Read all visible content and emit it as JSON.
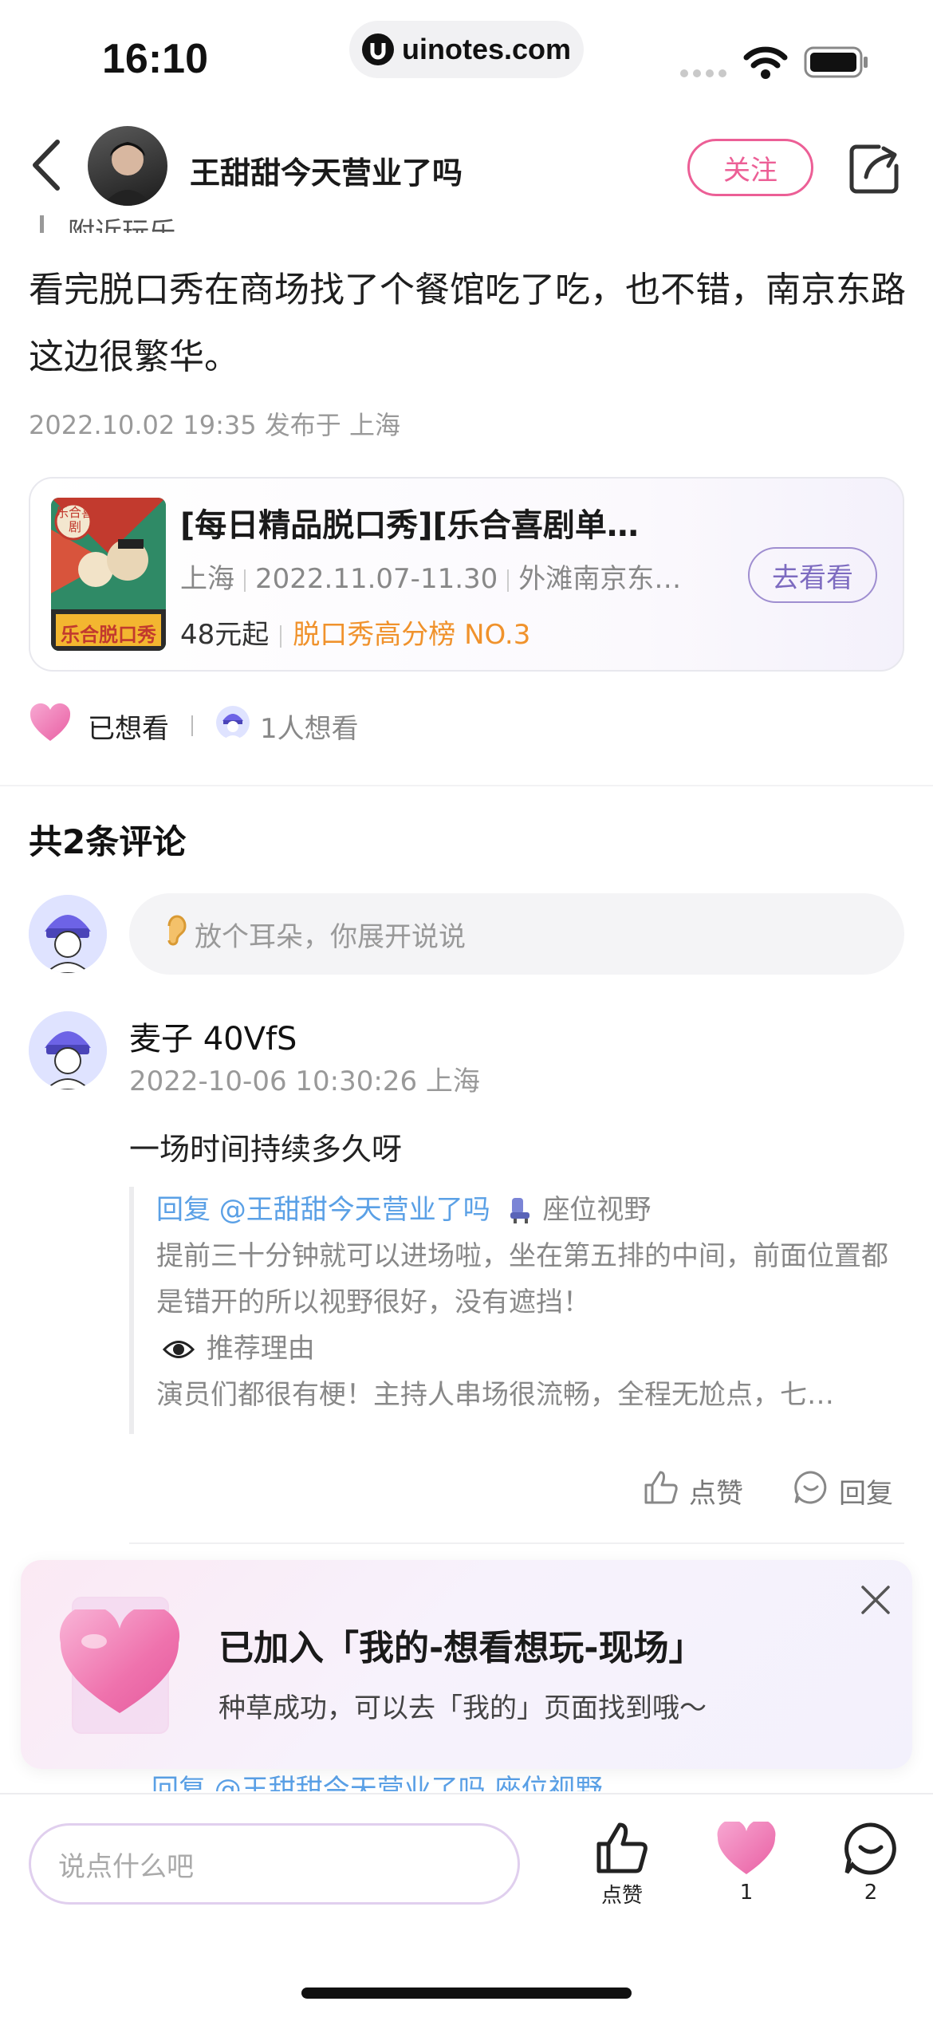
{
  "status_bar": {
    "time": "16:10",
    "url": "uinotes.com"
  },
  "header": {
    "author_name": "王甜甜今天营业了吗",
    "follow_label": "关注"
  },
  "post": {
    "cut_tag": "附近玩乐",
    "body": "看完脱口秀在商场找了个餐馆吃了吃，也不错，南京东路这边很繁华。",
    "meta": "2022.10.02 19:35 发布于 上海"
  },
  "show_card": {
    "title": "[每日精品脱口秀][乐合喜剧单…",
    "city": "上海",
    "dates": "2022.11.07-11.30",
    "venue": "外滩南京东…",
    "price": "48元起",
    "rank": "脱口秀高分榜 NO.3",
    "go_label": "去看看",
    "poster_text_top": "乐合喜剧",
    "poster_text_bottom": "乐合脱口秀"
  },
  "want_row": {
    "label": "已想看",
    "count": "1人想看"
  },
  "comments": {
    "title": "共2条评论",
    "input_placeholder": "放个耳朵，你展开说说",
    "items": [
      {
        "user": "麦子 40VfS",
        "meta": "2022-10-06 10:30:26 上海",
        "text": "一场时间持续多久呀",
        "reply_prefix": "回复 @王甜甜今天营业了吗",
        "reply_seat_label": "座位视野",
        "reply_body": "提前三十分钟就可以进场啦，坐在第五排的中间，前面位置都是错开的所以视野很好，没有遮挡！",
        "reason_label": "推荐理由",
        "reason_text": "演员们都很有梗！主持人串场很流畅，全程无尬点，七…",
        "like_label": "点赞",
        "reply_label": "回复"
      }
    ],
    "next_reply_peek": "回复 @王甜甜今天营业了吗  座位视野"
  },
  "toast": {
    "title": "已加入「我的-想看想玩-现场」",
    "subtitle": "种草成功，可以去「我的」页面找到哦～"
  },
  "bottom_bar": {
    "input_placeholder": "说点什么吧",
    "like_label": "点赞",
    "heart_count": "1",
    "comment_count": "2"
  },
  "colors": {
    "accent_pink": "#ec5f96",
    "link_blue": "#5aa0e6",
    "rank_orange": "#f0922c"
  }
}
